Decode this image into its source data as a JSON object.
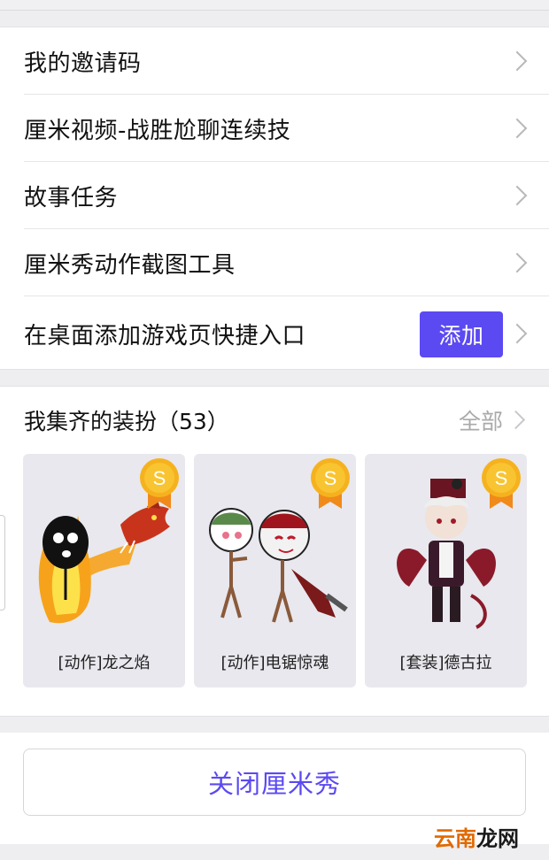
{
  "menu": {
    "items": [
      {
        "label": "我的邀请码"
      },
      {
        "label": "厘米视频-战胜尬聊连续技"
      },
      {
        "label": "故事任务"
      },
      {
        "label": "厘米秀动作截图工具"
      },
      {
        "label": "在桌面添加游戏页快捷入口",
        "button": "添加"
      }
    ]
  },
  "collection": {
    "title": "我集齐的装扮（53）",
    "all_label": "全部",
    "badge_letter": "S",
    "items": [
      {
        "name": "[动作]龙之焰"
      },
      {
        "name": "[动作]电锯惊魂"
      },
      {
        "name": "[套装]德古拉"
      }
    ]
  },
  "footer": {
    "close_label": "关闭厘米秀"
  },
  "watermark": {
    "part1": "云南",
    "part2": "龙网"
  },
  "colors": {
    "accent": "#5b49f2",
    "badge": "#f5b020",
    "tile_bg": "#e8e8ee"
  }
}
